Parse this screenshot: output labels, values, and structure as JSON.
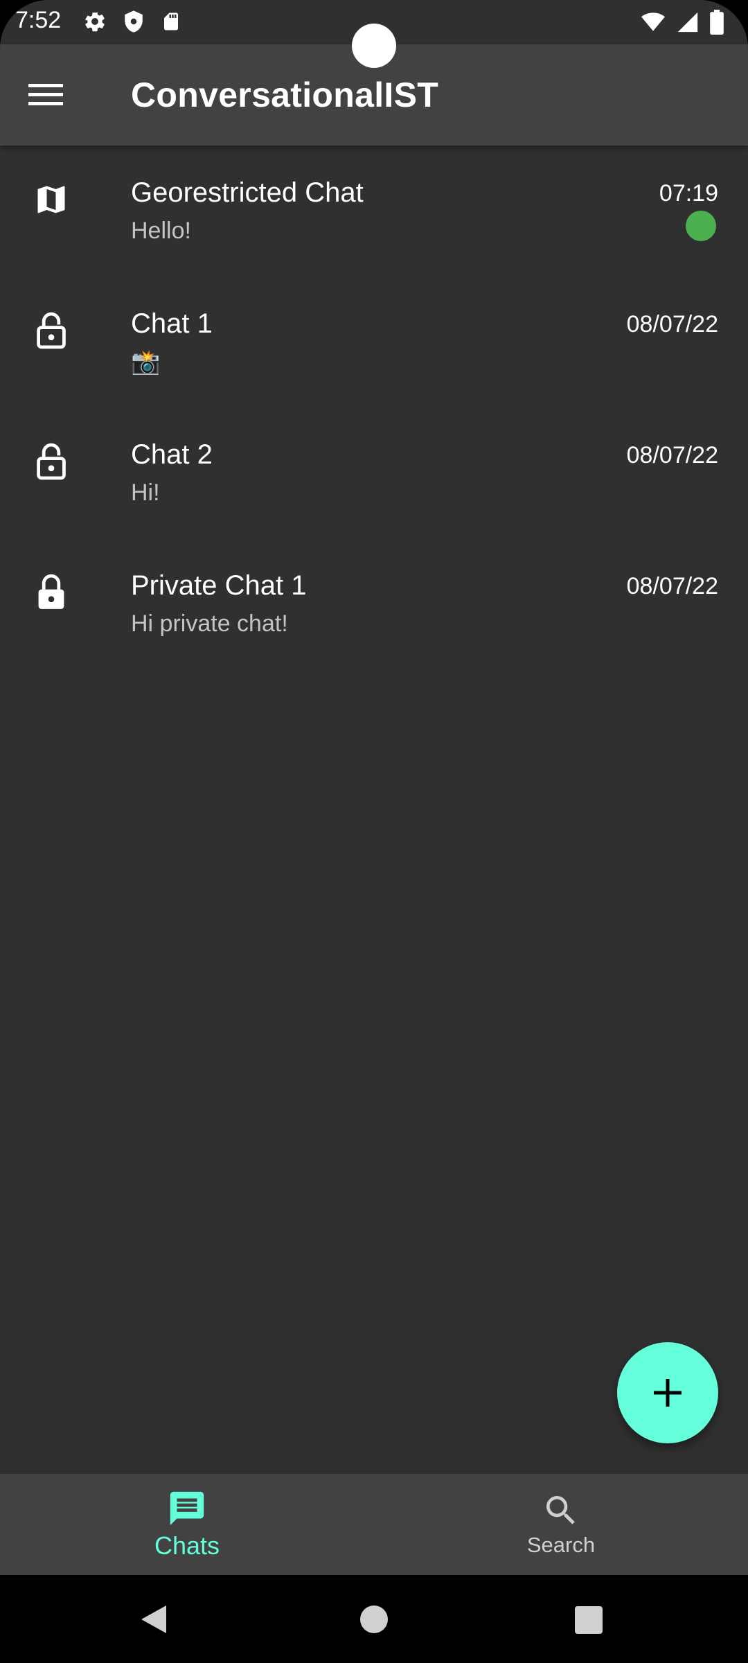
{
  "status_bar": {
    "time": "7:52",
    "left_icons": [
      "settings-icon",
      "shield-icon",
      "sd-card-icon"
    ],
    "right_icons": [
      "wifi-icon",
      "signal-icon",
      "battery-icon"
    ]
  },
  "app_bar": {
    "title": "ConversationalIST",
    "menu_icon": "menu-icon"
  },
  "chats": [
    {
      "icon": "map-icon",
      "name": "Georestricted Chat",
      "preview": "Hello!",
      "time": "07:19",
      "unread": true
    },
    {
      "icon": "lock-open-icon",
      "name": "Chat 1",
      "preview": "📸",
      "time": "08/07/22",
      "unread": false
    },
    {
      "icon": "lock-open-icon",
      "name": "Chat 2",
      "preview": "Hi!",
      "time": "08/07/22",
      "unread": false
    },
    {
      "icon": "lock-icon",
      "name": "Private Chat 1",
      "preview": "Hi private chat!",
      "time": "08/07/22",
      "unread": false
    }
  ],
  "fab": {
    "icon": "plus-icon"
  },
  "bottom_nav": {
    "tabs": [
      {
        "label": "Chats",
        "icon": "chat-icon",
        "active": true
      },
      {
        "label": "Search",
        "icon": "search-icon",
        "active": false
      }
    ]
  },
  "colors": {
    "accent": "#64ffda",
    "background": "#303030",
    "app_bar": "#424242",
    "unread_dot": "#4caf50"
  }
}
